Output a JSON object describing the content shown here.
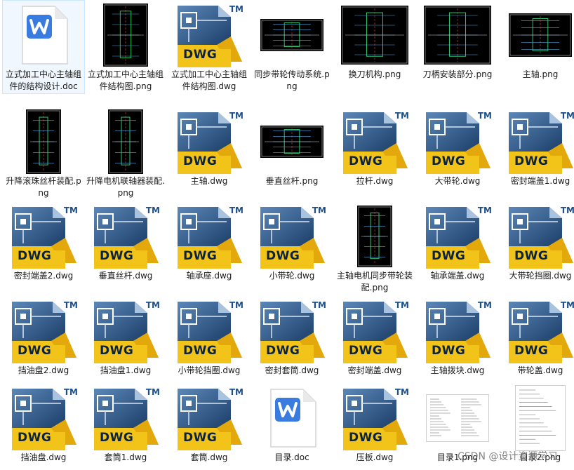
{
  "files": [
    {
      "name": "立式加工中心主轴组件的结构设计.doc",
      "type": "doc",
      "selected": true
    },
    {
      "name": "立式加工中心主轴组件结构图.png",
      "type": "png",
      "variant": "tall-green"
    },
    {
      "name": "立式加工中心主轴组件结构图.dwg",
      "type": "dwg"
    },
    {
      "name": "同步带轮传动系统.png",
      "type": "png",
      "variant": "wide-small"
    },
    {
      "name": "换刀机构.png",
      "type": "png",
      "variant": "square"
    },
    {
      "name": "刀柄安装部分.png",
      "type": "png",
      "variant": "square"
    },
    {
      "name": "主轴.png",
      "type": "png",
      "variant": "wide"
    },
    {
      "name": "升降滚珠丝杆装配.png",
      "type": "png",
      "variant": "tall"
    },
    {
      "name": "升降电机联轴器装配.png",
      "type": "png",
      "variant": "tall"
    },
    {
      "name": "主轴.dwg",
      "type": "dwg"
    },
    {
      "name": "垂直丝杆.png",
      "type": "png",
      "variant": "wide-small"
    },
    {
      "name": "拉杆.dwg",
      "type": "dwg"
    },
    {
      "name": "大带轮.dwg",
      "type": "dwg"
    },
    {
      "name": "密封端盖1.dwg",
      "type": "dwg"
    },
    {
      "name": "密封端盖2.dwg",
      "type": "dwg"
    },
    {
      "name": "垂直丝杆.dwg",
      "type": "dwg"
    },
    {
      "name": "轴承座.dwg",
      "type": "dwg"
    },
    {
      "name": "小带轮.dwg",
      "type": "dwg"
    },
    {
      "name": "主轴电机同步带轮装配.png",
      "type": "png",
      "variant": "tall-narrow"
    },
    {
      "name": "轴承端盖.dwg",
      "type": "dwg"
    },
    {
      "name": "大带轮挡圈.dwg",
      "type": "dwg"
    },
    {
      "name": "挡油盘2.dwg",
      "type": "dwg"
    },
    {
      "name": "挡油盘1.dwg",
      "type": "dwg"
    },
    {
      "name": "小带轮挡圈.dwg",
      "type": "dwg"
    },
    {
      "name": "密封套筒.dwg",
      "type": "dwg"
    },
    {
      "name": "密封端盖.dwg",
      "type": "dwg"
    },
    {
      "name": "主轴拨块.dwg",
      "type": "dwg"
    },
    {
      "name": "带轮盖.dwg",
      "type": "dwg"
    },
    {
      "name": "挡油盘.dwg",
      "type": "dwg"
    },
    {
      "name": "套筒1.dwg",
      "type": "dwg"
    },
    {
      "name": "套筒.dwg",
      "type": "dwg"
    },
    {
      "name": "目录.doc",
      "type": "doc"
    },
    {
      "name": "压板.dwg",
      "type": "dwg"
    },
    {
      "name": "目录1.png",
      "type": "png",
      "variant": "doc-pages"
    },
    {
      "name": "目录2.png",
      "type": "png",
      "variant": "doc-page"
    }
  ],
  "icon_text": {
    "dwg": "DWG",
    "tm": "TM"
  },
  "watermark": "CSDN @设计资源学习",
  "colors": {
    "dwg_blue": "#1e4f86",
    "dwg_yellow": "#f2c318",
    "word_blue": "#3a7be0",
    "selection": "#cce8ff"
  }
}
